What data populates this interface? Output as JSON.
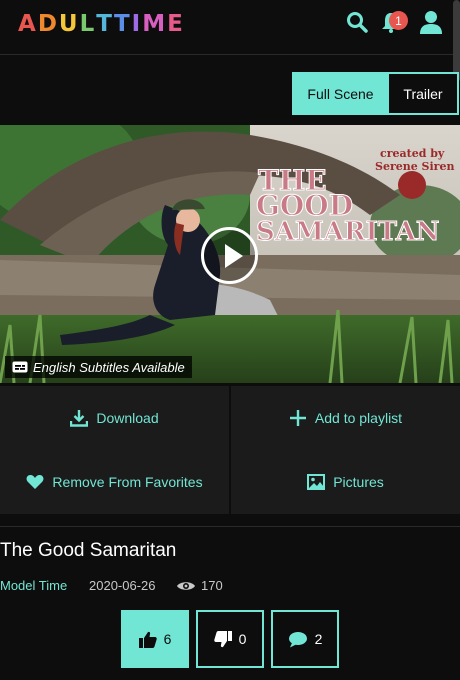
{
  "header": {
    "logo_letters": [
      "A",
      "D",
      "U",
      "L",
      "T",
      "T",
      "I",
      "M",
      "E"
    ],
    "logo_colors": [
      "#e8574f",
      "#f0892e",
      "#f4c63a",
      "#7bc96f",
      "#56b6d9",
      "#5b8ee6",
      "#9b6ce6",
      "#d65fbf",
      "#e85a8c"
    ],
    "search_icon": "search-icon",
    "bell_icon": "bell-icon",
    "notification_count": "1",
    "user_icon": "user-icon"
  },
  "tabs": [
    {
      "label": "Full Scene",
      "active": true
    },
    {
      "label": "Trailer",
      "active": false
    }
  ],
  "hero": {
    "title_line1": "THE",
    "title_line2": "GOOD",
    "title_line3": "SAMARITAN",
    "created_by_line1": "created by",
    "created_by_line2": "Serene Siren",
    "subtitles_label": "English Subtitles Available",
    "play_icon": "play-icon"
  },
  "actions": {
    "download": "Download",
    "add_to_playlist": "Add to playlist",
    "remove_favorites": "Remove From Favorites",
    "pictures": "Pictures"
  },
  "scene": {
    "title": "The Good Samaritan",
    "model": "Model Time",
    "date": "2020-06-26",
    "views": "170"
  },
  "votes": {
    "likes": "6",
    "dislikes": "0",
    "comments": "2"
  },
  "colors": {
    "accent": "#72e6d4",
    "background": "#0d0d0d",
    "panel": "#1b1b1b",
    "badge": "#e8574f"
  }
}
